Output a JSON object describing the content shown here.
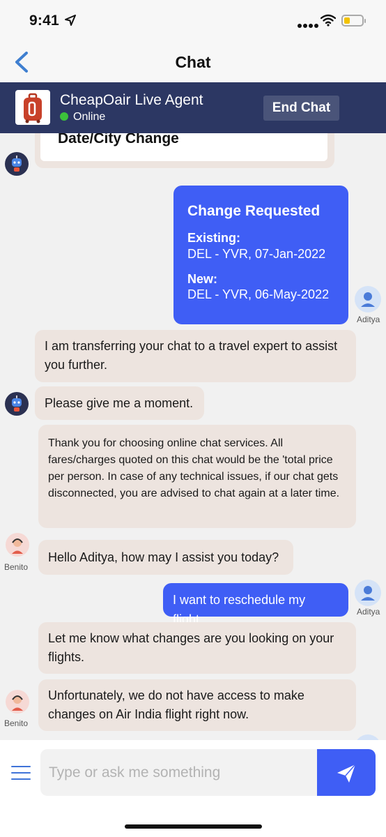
{
  "status_bar": {
    "time": "9:41"
  },
  "nav": {
    "title": "Chat",
    "back_icon": "chevron-left-icon"
  },
  "agent_header": {
    "name": "CheapOair Live Agent",
    "status": "Online",
    "end_chat_label": "End Chat",
    "status_color": "#3cc13b"
  },
  "messages": {
    "date_city_change": "Date/City Change",
    "change_request": {
      "heading": "Change Requested",
      "existing_label": "Existing:",
      "existing_value": "DEL - YVR, 07-Jan-2022",
      "new_label": "New:",
      "new_value": "DEL - YVR, 06-May-2022",
      "sender": "Aditya"
    },
    "transfer": "I am transferring your chat to a travel expert to assist you further.",
    "moment": "Please give me a moment.",
    "disclaimer": "Thank you for choosing online chat services. All fares/charges quoted on this chat would be the 'total price per person. In case of any technical issues, if our chat gets disconnected, you are advised to chat again at a later time.",
    "greeting": {
      "text": "Hello Aditya, how may I assist you today?",
      "sender": "Benito"
    },
    "reschedule": {
      "text": "I want to reschedule my flight.",
      "sender": "Aditya"
    },
    "changes_query": "Let me know what changes are you looking on your flights.",
    "no_access": {
      "text": "Unfortunately, we do not have access to make changes on Air India flight right now.",
      "sender": "Benito"
    }
  },
  "input": {
    "placeholder": "Type or ask me something"
  },
  "colors": {
    "accent": "#3f5ef5",
    "header_bg": "#2c3763",
    "agent_bubble": "#ede4df"
  }
}
